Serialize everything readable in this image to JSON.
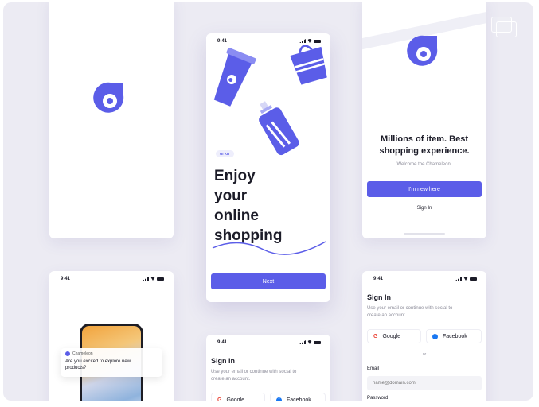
{
  "status_time": "9:41",
  "colors": {
    "accent": "#5b5de8",
    "background": "#ecebf3",
    "card": "#ffffff",
    "text": "#1c1c28"
  },
  "icons": {
    "logo": "chameleon-logo-icon",
    "gallery": "stacked-frames-icon",
    "google": "google-icon",
    "facebook": "facebook-icon"
  },
  "splash": {},
  "onboarding": {
    "tag": "UI KIT",
    "headline_lines": [
      "Enjoy",
      "your",
      "online",
      "shopping"
    ],
    "next_label": "Next"
  },
  "welcome": {
    "title_lines": [
      "Millions of item. Best",
      "shopping experience."
    ],
    "subtitle": "Welcome the Chameleon!",
    "primary_label": "I'm new here",
    "secondary_label": "Sign In"
  },
  "notification": {
    "app_name": "Chameleon",
    "message_lines": [
      "Are you excited to explore new",
      "products?"
    ]
  },
  "signin": {
    "title": "Sign In",
    "description_lines": [
      "Use your email or continue with social to",
      "create an account."
    ],
    "google_label": "Google",
    "facebook_label": "Facebook",
    "or_label": "or",
    "email_label": "Email",
    "email_placeholder": "name@domain.com",
    "password_label": "Password"
  }
}
